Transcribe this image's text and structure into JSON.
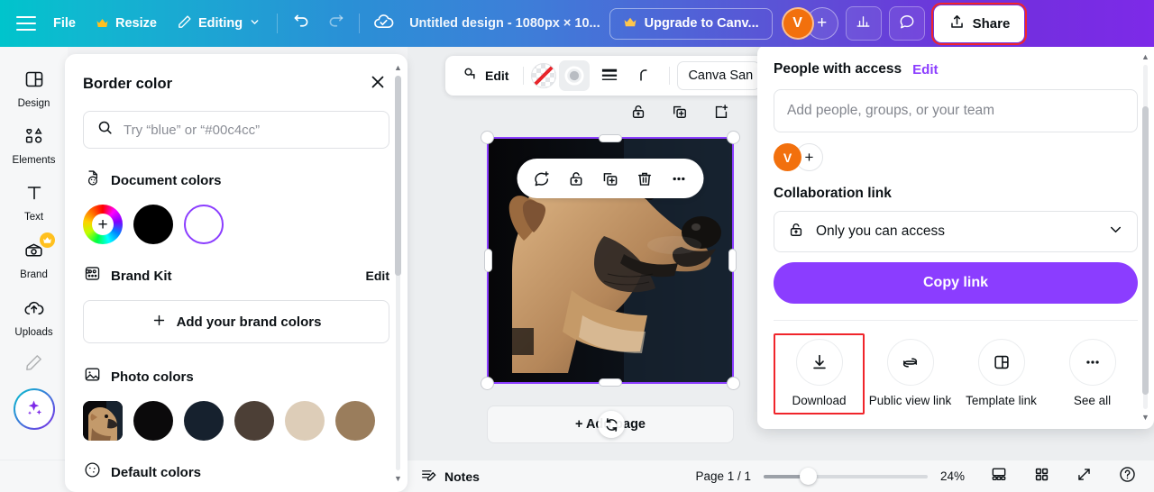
{
  "topbar": {
    "menu_icon": "hamburger-icon",
    "file_label": "File",
    "resize_label": "Resize",
    "resize_badge": "crown-icon",
    "editing_label": "Editing",
    "undo_icon": "undo-icon",
    "redo_icon": "redo-icon",
    "cloud_icon": "cloud-saved-icon",
    "doc_title": "Untitled design - 1080px × 10...",
    "upgrade_label": "Upgrade to Canv...",
    "upgrade_badge": "crown-icon",
    "avatar_initial": "V",
    "avatar_add_icon": "plus-icon",
    "insights_icon": "bar-chart-icon",
    "comment_icon": "comment-bubble-icon",
    "share_label": "Share",
    "share_icon": "share-upload-icon",
    "colors": {
      "gradient_start": "#00c4cc",
      "gradient_mid": "#2a90d6",
      "gradient_end": "#7d2ae8",
      "avatar_bg": "#f2700d",
      "highlight_outline": "#f0252b"
    }
  },
  "rail": {
    "items": [
      {
        "label": "Design",
        "icon": "design-layout-icon",
        "badge": null
      },
      {
        "label": "Elements",
        "icon": "elements-shapes-icon",
        "badge": null
      },
      {
        "label": "Text",
        "icon": "text-t-icon",
        "badge": null
      },
      {
        "label": "Brand",
        "icon": "brand-kit-icon",
        "badge": "crown-icon"
      },
      {
        "label": "Uploads",
        "icon": "uploads-cloud-icon",
        "badge": null
      }
    ],
    "pen_icon": "pen-draw-icon",
    "magic_icon": "magic-sparkles-icon"
  },
  "panel": {
    "title": "Border color",
    "close_icon": "close-x-icon",
    "search": {
      "icon": "search-icon",
      "placeholder": "Try “blue” or “#00c4cc”",
      "value": ""
    },
    "document_colors": {
      "icon": "document-colors-icon",
      "title": "Document colors",
      "swatches": [
        {
          "name": "color-wheel-add",
          "hex": "rainbow"
        },
        {
          "name": "black-swatch",
          "hex": "#000000"
        },
        {
          "name": "white-selected-swatch",
          "hex": "#ffffff"
        }
      ]
    },
    "brand_kit": {
      "icon": "brand-kit-icon",
      "title": "Brand Kit",
      "edit_label": "Edit",
      "add_label": "Add your brand colors",
      "add_icon": "plus-icon"
    },
    "photo_colors": {
      "icon": "photo-image-icon",
      "title": "Photo colors",
      "thumbnail_name": "dog-photo-thumbnail",
      "swatches": [
        "#0b0a0b",
        "#16212e",
        "#4c3f36",
        "#ddcdb8",
        "#97apx"
      ]
    },
    "default_colors": {
      "icon": "palette-icon",
      "title": "Default colors"
    },
    "scroll_up_icon": "scroll-up-arrow",
    "scroll_down_icon": "scroll-down-arrow"
  },
  "element_toolbar": {
    "edit_label": "Edit",
    "edit_icon": "edit-photo-icon",
    "none_color_icon": "no-color-swatch",
    "border_color_icon": "border-color-ring",
    "border_weight_icon": "border-weight-icon",
    "corner_radius_icon": "corner-radius-icon",
    "font_name": "Canva San"
  },
  "canvas": {
    "element_outer_icons": [
      "lock-icon",
      "duplicate-icon",
      "add-to-page-icon"
    ],
    "floating_bar_icons": [
      "comment-add-icon",
      "lock-icon",
      "duplicate-icon",
      "trash-icon",
      "more-dots-icon"
    ],
    "selection_color": "#8b3dff",
    "add_page_label": "+ Add page",
    "cursor_icon": "rotate-cursor-icon"
  },
  "share_panel": {
    "people_title": "People with access",
    "people_edit": "Edit",
    "people_input_placeholder": "Add people, groups, or your team",
    "people_input_value": "",
    "avatar_initial": "V",
    "avatar_add_icon": "plus-icon",
    "collab_title": "Collaboration link",
    "access_icon": "lock-icon",
    "access_value": "Only you can access",
    "access_chevron": "chevron-down-icon",
    "copy_link_label": "Copy link",
    "copy_link_color": "#8b3dff",
    "actions": [
      {
        "label": "Download",
        "icon": "download-icon",
        "highlighted": true
      },
      {
        "label": "Public view link",
        "icon": "link-chain-icon",
        "highlighted": false
      },
      {
        "label": "Template link",
        "icon": "template-grid-icon",
        "highlighted": false
      },
      {
        "label": "See all",
        "icon": "more-dots-icon",
        "highlighted": false
      }
    ],
    "scroll_up_icon": "scroll-up-arrow",
    "scroll_down_icon": "scroll-down-arrow"
  },
  "bottombar": {
    "notes_label": "Notes",
    "notes_icon": "notes-icon",
    "page_count": "Page 1 / 1",
    "zoom_value": "24%",
    "grid_view_icon": "page-view-icon",
    "all_pages_icon": "grid-view-icon",
    "fullscreen_icon": "expand-icon",
    "help_icon": "help-question-icon"
  }
}
